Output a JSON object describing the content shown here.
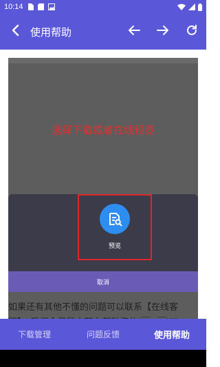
{
  "status_bar": {
    "time": "10:14",
    "left_icons": [
      "sim-icon",
      "sd-card-icon",
      "image-icon"
    ],
    "right_icons": [
      "wifi-icon",
      "signal-icon",
      "battery-icon"
    ]
  },
  "app_bar": {
    "title": "使用帮助",
    "icons": [
      "back-arrow-icon",
      "arrow-left-icon",
      "arrow-right-icon",
      "refresh-icon"
    ]
  },
  "content": {
    "preview_headline": "选择下载或者在线预览",
    "sheet_option_label": "预览",
    "sheet_option_icon": "preview-icon",
    "cancel_label": "取消",
    "help_line_1": "如果还有其他不懂的问题可以联系【在线客",
    "help_line_2": "服】，我们会尽最大努力帮助您的(￣▽￣)\"\""
  },
  "bottom_nav": {
    "items": [
      {
        "label": "下载管理",
        "active": false
      },
      {
        "label": "问题反馈",
        "active": false
      },
      {
        "label": "使用帮助",
        "active": true
      }
    ]
  },
  "colors": {
    "primary": "#5b57d9",
    "highlight_red": "#e0262a",
    "headline_red": "#e2312f",
    "option_blue": "#2e8df0",
    "cancel_purple": "#6a5bb7"
  }
}
